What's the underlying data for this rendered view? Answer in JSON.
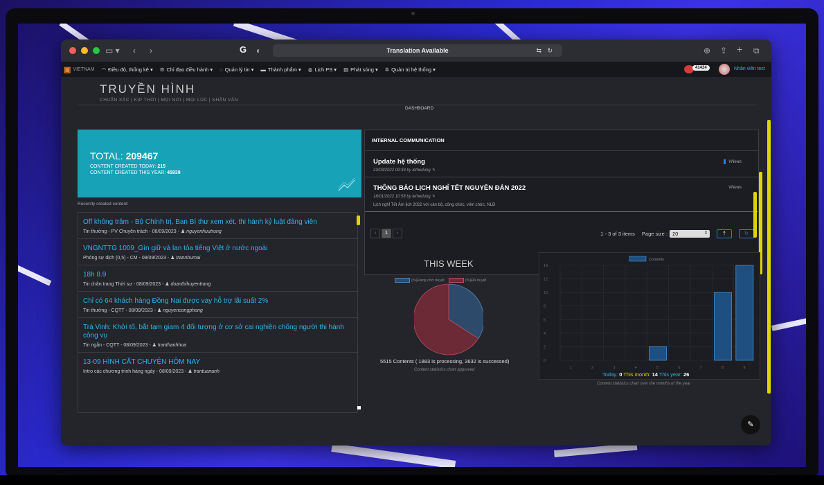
{
  "browser": {
    "url_text": "Translation Available",
    "logo_letter": "G"
  },
  "navbar": {
    "logo_text": "VIETNAM",
    "items": [
      {
        "label": "Điều độ, thống kê ▾",
        "icon": "gauge-icon"
      },
      {
        "label": "Chỉ đạo điều hành ▾",
        "icon": "gear-icon"
      },
      {
        "label": "Quản lý tin ▾",
        "icon": "chat-icon"
      },
      {
        "label": "Thành phẩm ▾",
        "icon": "folder-icon"
      },
      {
        "label": "Lịch PS ▾",
        "icon": "calendar-icon"
      },
      {
        "label": "Phát sóng ▾",
        "icon": "broadcast-icon"
      },
      {
        "label": "Quản trị hệ thống ▾",
        "icon": "cog-icon"
      }
    ],
    "badge_count": "41424",
    "user_name": "Nhân viên test"
  },
  "brand": {
    "title": "TRUYỀN HÌNH",
    "tagline": "CHUẨN XÁC | KỊP THỜI | MỌI NƠI | MỌI LÚC | NHÂN VĂN"
  },
  "dashboard_label": "DASHBOARD",
  "totals": {
    "total_label": "TOTAL:",
    "total_value": "209467",
    "today_label": "CONTENT CREATED TODAY:",
    "today_value": "215",
    "year_label": "CONTENT CREATED THIS YEAR:",
    "year_value": "45939"
  },
  "recent": {
    "label": "Recently created content:",
    "items": [
      {
        "title": "Off không trâm - Bộ Chính trị, Ban Bí thư xem xét, thi hành kỷ luật đảng viên",
        "meta": "Tin thường - PV Chuyên trách - 08/09/2023 -",
        "user": "nguyenhuutrung"
      },
      {
        "title": "VNGNTTG 1009_Gìn giữ và lan tỏa tiếng Việt ở nước ngoài",
        "meta": "Phóng sự dịch (0,5) - CM - 08/09/2023 -",
        "user": "trannhumai"
      },
      {
        "title": "18h 8.9",
        "meta": "Tin chân trang Thời sự - 08/09/2023 -",
        "user": "doanthihuyentrang"
      },
      {
        "title": "Chỉ có 64 khách hàng Đồng Nai được vay hỗ trợ lãi suất 2%",
        "meta": "Tin thường - CQTT - 08/09/2023 -",
        "user": "nguyencongphong"
      },
      {
        "title": "Trà Vinh: Khởi tố, bắt tạm giam 4 đối tượng ở cơ sở cai nghiện chống người thi hành công vụ",
        "meta": "Tin ngắn - CQTT - 08/09/2023 -",
        "user": "tranthanhhoa"
      },
      {
        "title": "13-09 HÌNH CẮT CHUYỆN HÔM NAY",
        "meta": "Intro các chương trình hàng ngày - 08/09/2023 -",
        "user": "trantuananh"
      }
    ]
  },
  "internal": {
    "header": "INTERNAL COMMUNICATION",
    "items": [
      {
        "title": "Update hệ thống",
        "date": "23/03/2022 09:39 by lethedung",
        "excerpt": "",
        "tag": "VNews"
      },
      {
        "title": "THÔNG BÁO LỊCH NGHỈ TẾT NGUYÊN ĐÁN 2022",
        "date": "18/01/2022 10:58 by lethedung",
        "excerpt": "Lịch nghỉ Tết Âm lịch 2022 với cán bộ, công chức, viên chức, NLĐ",
        "tag": "VNews"
      }
    ],
    "pager": {
      "current_page": "1",
      "summary": "1 - 3 of 3 items",
      "page_size_label": "Page size :",
      "page_size_value": "20"
    }
  },
  "week": {
    "title": "THIS WEEK",
    "caption": "5515 Contents ( 1883 is processing, 3632 is successed)",
    "sub": "Content statistics chart approved"
  },
  "stats": {
    "today_label": "Today:",
    "today_value": "0",
    "month_label": "This month:",
    "month_value": "14",
    "year_label": "This year:",
    "year_value": "26",
    "sub": "Content statistics chart over the months of the year"
  },
  "colors": {
    "accent_cyan": "#18a2b8",
    "link_blue": "#30b4e8",
    "pie_blue": "#2e4a6b",
    "pie_red": "#6b2a35",
    "highlight_yellow": "#e0d500"
  },
  "chart_data": [
    {
      "type": "pie",
      "title": "THIS WEEK",
      "series": [
        {
          "name": "(%)Đang chờ duyệt",
          "values": [
            34.1
          ]
        },
        {
          "name": "(%)Đã duyệt",
          "values": [
            65.9
          ]
        }
      ],
      "categories": [
        "(%)Đang chờ duyệt",
        "(%)Đã duyệt"
      ],
      "values": [
        34.1,
        65.9
      ],
      "legend": "top"
    },
    {
      "type": "bar",
      "title": "",
      "categories": [
        "1",
        "2",
        "3",
        "4",
        "5",
        "6",
        "7",
        "8",
        "9"
      ],
      "series": [
        {
          "name": "Contents",
          "values": [
            0,
            0,
            0,
            0,
            2,
            0,
            0,
            10,
            14
          ]
        }
      ],
      "ylim": [
        0,
        14
      ],
      "yticks": [
        "0",
        "2",
        "4",
        "6",
        "8",
        "10",
        "12",
        "14"
      ],
      "xlabel": "",
      "ylabel": "",
      "grid": true,
      "legend": "top"
    }
  ]
}
